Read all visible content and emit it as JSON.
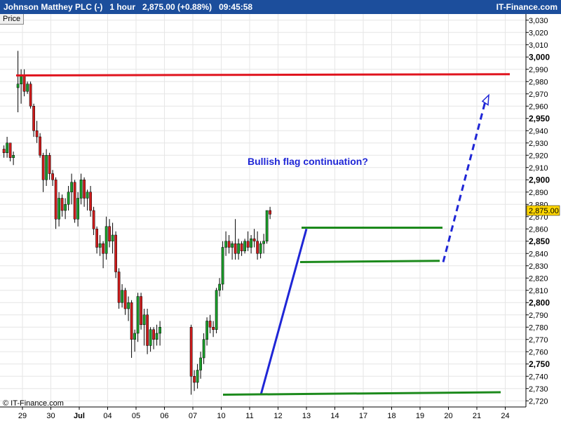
{
  "header": {
    "title": "Johnson Matthey PLC (-)   1 hour   2,875.00 (+0.88%)   09:45:58",
    "site": "IT-Finance.com"
  },
  "price_tab": "Price",
  "copyright": "© IT-Finance.com",
  "annotation": "Bullish flag continuation?",
  "last_price_label": "2,875.00",
  "colors": {
    "header_bg": "#1c4e9c",
    "up_candle": "#1a9e2a",
    "down_candle": "#d11b1b",
    "resistance_line": "#e0141e",
    "trend_line": "#1f26d6",
    "flag_lines": "#1c8a1c",
    "projection": "#1f26d6",
    "last_price_bg": "#ffd600"
  },
  "chart_data": {
    "type": "candlestick",
    "title": "Johnson Matthey PLC (-)",
    "interval": "1 hour",
    "ylim": [
      2715,
      3035
    ],
    "y_ticks": [
      3030,
      3020,
      3010,
      3000,
      2990,
      2980,
      2970,
      2960,
      2950,
      2940,
      2930,
      2920,
      2910,
      2900,
      2890,
      2880,
      2870,
      2860,
      2850,
      2840,
      2830,
      2820,
      2810,
      2800,
      2790,
      2780,
      2770,
      2760,
      2750,
      2740,
      2730,
      2720
    ],
    "y_tick_labels": [
      "3,030",
      "3,020",
      "3,010",
      "3,000",
      "2,990",
      "2,980",
      "2,970",
      "2,960",
      "2,950",
      "2,940",
      "2,930",
      "2,920",
      "2,910",
      "2,900",
      "2,890",
      "2,880",
      "2,870",
      "2,860",
      "2,850",
      "2,840",
      "2,830",
      "2,820",
      "2,810",
      "2,800",
      "2,790",
      "2,780",
      "2,770",
      "2,760",
      "2,750",
      "2,740",
      "2,730",
      "2,720"
    ],
    "y_bold_ticks": [
      3000,
      2950,
      2900,
      2850,
      2800,
      2750
    ],
    "x_labels": [
      "29",
      "30",
      "Jul",
      "04",
      "05",
      "06",
      "07",
      "10",
      "11",
      "12",
      "13",
      "14",
      "17",
      "18",
      "19",
      "20",
      "21",
      "24"
    ],
    "x_label_index": [
      0,
      9,
      18,
      27,
      36,
      45,
      54,
      63,
      72,
      81,
      90,
      99,
      108,
      117,
      126,
      135,
      144,
      153
    ],
    "close_price": 2875.0,
    "candles": [
      [
        2925,
        2928,
        2918,
        2922
      ],
      [
        2922,
        2935,
        2918,
        2930
      ],
      [
        2930,
        2930,
        2915,
        2918
      ],
      [
        2918,
        2923,
        2912,
        2920
      ],
      [
        2975,
        3005,
        2955,
        2978
      ],
      [
        2978,
        2990,
        2962,
        2985
      ],
      [
        2985,
        2990,
        2968,
        2972
      ],
      [
        2972,
        2980,
        2970,
        2978
      ],
      [
        2978,
        2980,
        2958,
        2960
      ],
      [
        2960,
        2962,
        2935,
        2940
      ],
      [
        2940,
        2948,
        2930,
        2935
      ],
      [
        2935,
        2938,
        2918,
        2920
      ],
      [
        2920,
        2922,
        2890,
        2900
      ],
      [
        2900,
        2925,
        2895,
        2920
      ],
      [
        2920,
        2922,
        2900,
        2905
      ],
      [
        2905,
        2908,
        2895,
        2900
      ],
      [
        2900,
        2902,
        2860,
        2868
      ],
      [
        2868,
        2890,
        2862,
        2885
      ],
      [
        2885,
        2888,
        2870,
        2875
      ],
      [
        2875,
        2885,
        2868,
        2880
      ],
      [
        2880,
        2895,
        2875,
        2890
      ],
      [
        2890,
        2905,
        2880,
        2898
      ],
      [
        2898,
        2900,
        2865,
        2868
      ],
      [
        2868,
        2890,
        2862,
        2885
      ],
      [
        2885,
        2905,
        2880,
        2900
      ],
      [
        2900,
        2902,
        2878,
        2885
      ],
      [
        2885,
        2892,
        2875,
        2890
      ],
      [
        2890,
        2895,
        2870,
        2875
      ],
      [
        2875,
        2878,
        2855,
        2860
      ],
      [
        2860,
        2862,
        2840,
        2845
      ],
      [
        2845,
        2855,
        2838,
        2848
      ],
      [
        2848,
        2850,
        2828,
        2840
      ],
      [
        2840,
        2870,
        2835,
        2862
      ],
      [
        2862,
        2868,
        2845,
        2850
      ],
      [
        2850,
        2865,
        2840,
        2855
      ],
      [
        2855,
        2858,
        2820,
        2825
      ],
      [
        2825,
        2828,
        2795,
        2800
      ],
      [
        2800,
        2815,
        2796,
        2810
      ],
      [
        2810,
        2812,
        2790,
        2795
      ],
      [
        2795,
        2805,
        2785,
        2800
      ],
      [
        2800,
        2802,
        2755,
        2770
      ],
      [
        2770,
        2778,
        2760,
        2775
      ],
      [
        2775,
        2808,
        2768,
        2805
      ],
      [
        2805,
        2808,
        2778,
        2782
      ],
      [
        2782,
        2795,
        2765,
        2790
      ],
      [
        2790,
        2795,
        2758,
        2765
      ],
      [
        2765,
        2780,
        2760,
        2778
      ],
      [
        2778,
        2780,
        2762,
        2770
      ],
      [
        2770,
        2782,
        2765,
        2775
      ],
      [
        2775,
        2785,
        2765,
        2780
      ],
      [
        2780,
        2782,
        2725,
        2740
      ],
      [
        2740,
        2745,
        2728,
        2735
      ],
      [
        2735,
        2750,
        2730,
        2745
      ],
      [
        2745,
        2760,
        2738,
        2755
      ],
      [
        2755,
        2775,
        2750,
        2770
      ],
      [
        2770,
        2788,
        2765,
        2785
      ],
      [
        2785,
        2790,
        2775,
        2780
      ],
      [
        2780,
        2785,
        2772,
        2778
      ],
      [
        2778,
        2812,
        2775,
        2810
      ],
      [
        2810,
        2820,
        2805,
        2815
      ],
      [
        2815,
        2850,
        2810,
        2845
      ],
      [
        2845,
        2858,
        2838,
        2850
      ],
      [
        2850,
        2855,
        2840,
        2845
      ],
      [
        2845,
        2850,
        2835,
        2848
      ],
      [
        2848,
        2868,
        2835,
        2840
      ],
      [
        2840,
        2852,
        2835,
        2848
      ],
      [
        2848,
        2850,
        2838,
        2842
      ],
      [
        2842,
        2852,
        2840,
        2850
      ],
      [
        2850,
        2858,
        2842,
        2845
      ],
      [
        2845,
        2855,
        2840,
        2852
      ],
      [
        2852,
        2860,
        2845,
        2850
      ],
      [
        2850,
        2858,
        2835,
        2840
      ],
      [
        2840,
        2850,
        2836,
        2848
      ],
      [
        2848,
        2856,
        2840,
        2850
      ],
      [
        2850,
        2872,
        2848,
        2875
      ],
      [
        2875,
        2878,
        2868,
        2872
      ]
    ]
  }
}
